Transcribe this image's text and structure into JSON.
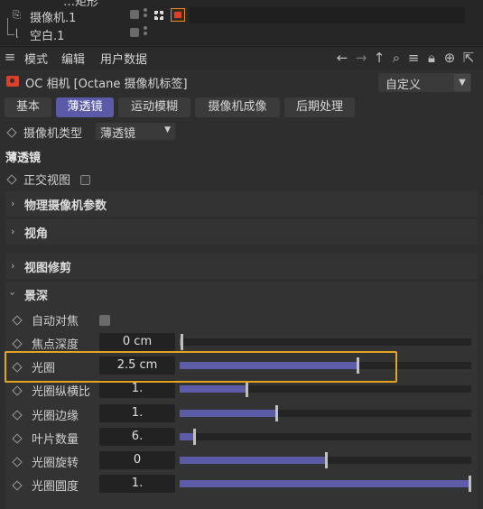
{
  "tree": {
    "rows": [
      {
        "label": "…矩形"
      },
      {
        "label": "摄像机.1"
      },
      {
        "label": "空白.1"
      }
    ]
  },
  "menubar": {
    "mode": "模式",
    "edit": "编辑",
    "user_data": "用户数据"
  },
  "object": {
    "title": "OC 相机 [Octane 摄像机标签]",
    "preset": "自定义"
  },
  "tabs": [
    {
      "label": "基本",
      "active": false
    },
    {
      "label": "薄透镜",
      "active": true
    },
    {
      "label": "运动模糊",
      "active": false
    },
    {
      "label": "摄像机成像",
      "active": false
    },
    {
      "label": "后期处理",
      "active": false
    }
  ],
  "camera_type": {
    "label": "摄像机类型",
    "value": "薄透镜"
  },
  "section": {
    "title": "薄透镜",
    "ortho_label": "正交视图"
  },
  "groups": [
    {
      "label": "物理摄像机参数",
      "expanded": false
    },
    {
      "label": "视角",
      "expanded": false
    },
    {
      "label": "视图修剪",
      "expanded": false
    },
    {
      "label": "景深",
      "expanded": true
    }
  ],
  "dof": {
    "auto_focus_label": "自动对焦",
    "params": [
      {
        "label": "焦点深度",
        "value": "0 cm",
        "fraction": 0.005
      },
      {
        "label": "光圈",
        "value": "2.5 cm",
        "fraction": 0.61
      },
      {
        "label": "光圈纵横比",
        "value": "1.",
        "fraction": 0.23
      },
      {
        "label": "光圈边缘",
        "value": "1.",
        "fraction": 0.33
      },
      {
        "label": "叶片数量",
        "value": "6.",
        "fraction": 0.05
      },
      {
        "label": "光圈旋转",
        "value": "0",
        "fraction": 0.5
      },
      {
        "label": "光圈圆度",
        "value": "1.",
        "fraction": 1.0
      }
    ]
  },
  "colors": {
    "accent": "#5a5aa8",
    "highlight": "#e5a421",
    "camera_icon": "#d9412a"
  }
}
